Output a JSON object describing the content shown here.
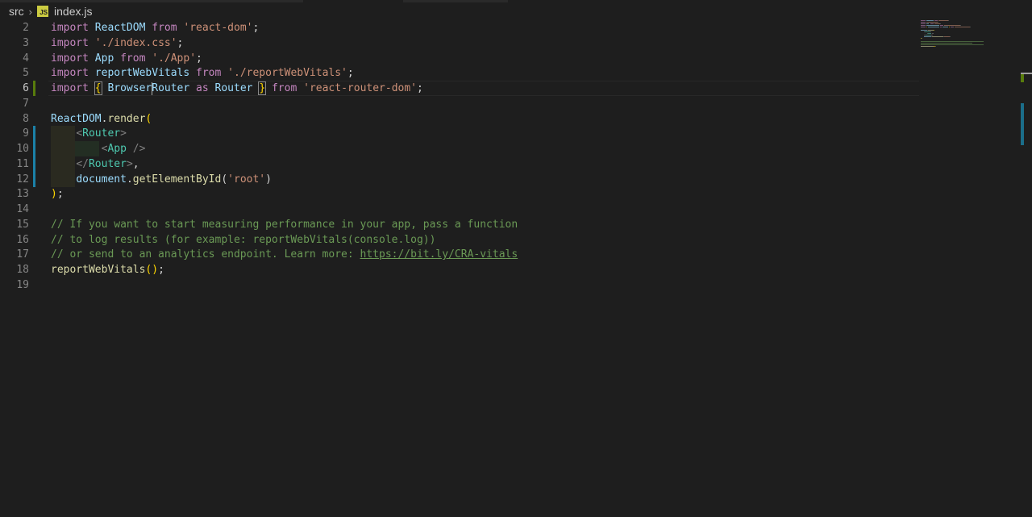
{
  "breadcrumb": {
    "folder": "src",
    "file_icon": "JS",
    "file": "index.js"
  },
  "editor": {
    "active_line": 6,
    "lines": [
      {
        "n": "2",
        "tokens": [
          [
            "kw",
            "import"
          ],
          [
            "pn",
            " "
          ],
          [
            "id",
            "ReactDOM"
          ],
          [
            "pn",
            " "
          ],
          [
            "kw",
            "from"
          ],
          [
            "pn",
            " "
          ],
          [
            "str",
            "'react-dom'"
          ],
          [
            "pn",
            ";"
          ]
        ]
      },
      {
        "n": "3",
        "tokens": [
          [
            "kw",
            "import"
          ],
          [
            "pn",
            " "
          ],
          [
            "str",
            "'./index.css'"
          ],
          [
            "pn",
            ";"
          ]
        ]
      },
      {
        "n": "4",
        "tokens": [
          [
            "kw",
            "import"
          ],
          [
            "pn",
            " "
          ],
          [
            "id",
            "App"
          ],
          [
            "pn",
            " "
          ],
          [
            "kw",
            "from"
          ],
          [
            "pn",
            " "
          ],
          [
            "str",
            "'./App'"
          ],
          [
            "pn",
            ";"
          ]
        ]
      },
      {
        "n": "5",
        "tokens": [
          [
            "kw",
            "import"
          ],
          [
            "pn",
            " "
          ],
          [
            "id",
            "reportWebVitals"
          ],
          [
            "pn",
            " "
          ],
          [
            "kw",
            "from"
          ],
          [
            "pn",
            " "
          ],
          [
            "str",
            "'./reportWebVitals'"
          ],
          [
            "pn",
            ";"
          ]
        ]
      },
      {
        "n": "6",
        "tokens": [
          [
            "kw",
            "import"
          ],
          [
            "pn",
            " "
          ],
          [
            "br",
            "{"
          ],
          [
            "pn",
            " "
          ],
          [
            "id",
            "Browser"
          ],
          [
            "cursor",
            ""
          ],
          [
            "id",
            "Router"
          ],
          [
            "pn",
            " "
          ],
          [
            "kw",
            "as"
          ],
          [
            "pn",
            " "
          ],
          [
            "id",
            "Router"
          ],
          [
            "pn",
            " "
          ],
          [
            "br",
            "}"
          ],
          [
            "pn",
            " "
          ],
          [
            "kw",
            "from"
          ],
          [
            "pn",
            " "
          ],
          [
            "str",
            "'react-router-dom'"
          ],
          [
            "pn",
            ";"
          ]
        ]
      },
      {
        "n": "7",
        "tokens": []
      },
      {
        "n": "8",
        "tokens": [
          [
            "id",
            "ReactDOM"
          ],
          [
            "pn",
            "."
          ],
          [
            "fn",
            "render"
          ],
          [
            "br",
            "("
          ]
        ]
      },
      {
        "n": "9",
        "tokens": [
          [
            "pn",
            "    "
          ],
          [
            "tagp",
            "<"
          ],
          [
            "tag",
            "Router"
          ],
          [
            "tagp",
            ">"
          ]
        ]
      },
      {
        "n": "10",
        "tokens": [
          [
            "pn",
            "        "
          ],
          [
            "tagp",
            "<"
          ],
          [
            "tag",
            "App"
          ],
          [
            "pn",
            " "
          ],
          [
            "tagp",
            "/>"
          ]
        ]
      },
      {
        "n": "11",
        "tokens": [
          [
            "pn",
            "    "
          ],
          [
            "tagp",
            "</"
          ],
          [
            "tag",
            "Router"
          ],
          [
            "tagp",
            ">"
          ],
          [
            "pn",
            ","
          ]
        ]
      },
      {
        "n": "12",
        "tokens": [
          [
            "pn",
            "    "
          ],
          [
            "id",
            "document"
          ],
          [
            "pn",
            "."
          ],
          [
            "fn",
            "getElementById"
          ],
          [
            "pn",
            "("
          ],
          [
            "str",
            "'root'"
          ],
          [
            "pn",
            ")"
          ]
        ]
      },
      {
        "n": "13",
        "tokens": [
          [
            "br",
            ")"
          ],
          [
            "pn",
            ";"
          ]
        ]
      },
      {
        "n": "14",
        "tokens": []
      },
      {
        "n": "15",
        "tokens": [
          [
            "cm",
            "// If you want to start measuring performance in your app, pass a function"
          ]
        ]
      },
      {
        "n": "16",
        "tokens": [
          [
            "cm",
            "// to log results (for example: reportWebVitals(console.log))"
          ]
        ]
      },
      {
        "n": "17",
        "tokens": [
          [
            "cm",
            "// or send to an analytics endpoint. Learn more: "
          ],
          [
            "url",
            "https://bit.ly/CRA-vitals"
          ]
        ]
      },
      {
        "n": "18",
        "tokens": [
          [
            "fn",
            "reportWebVitals"
          ],
          [
            "br",
            "()"
          ],
          [
            "pn",
            ";"
          ]
        ]
      },
      {
        "n": "19",
        "tokens": []
      }
    ]
  },
  "colors": {
    "background": "#1e1e1e",
    "keyword": "#c586c0",
    "identifier": "#9cdcfe",
    "string": "#ce9178",
    "function": "#dcdcaa",
    "tag": "#4ec9b0",
    "comment": "#6a9955",
    "git_modified": "#1b81a8",
    "git_added": "#587c0c"
  }
}
